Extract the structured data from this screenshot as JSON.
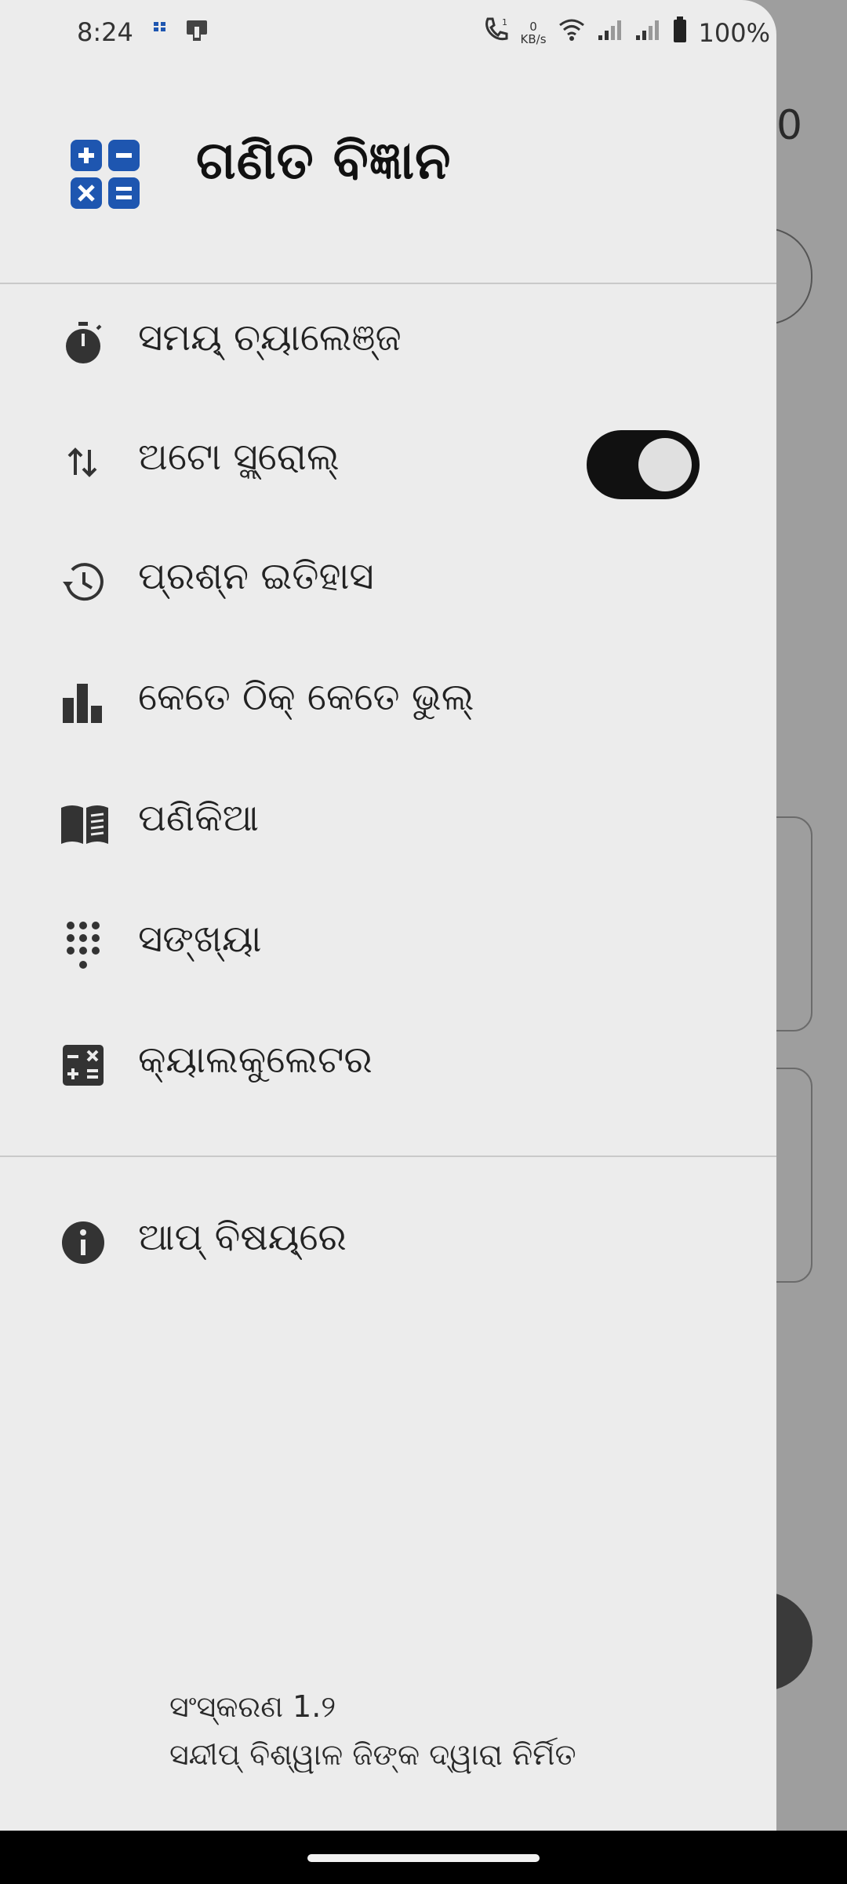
{
  "status_bar": {
    "time": "8:24",
    "net_speed_value": "0",
    "net_speed_unit": "KB/s",
    "battery": "100%"
  },
  "background": {
    "digit": "0"
  },
  "drawer": {
    "app_title": "ଗଣିତ ବିଜ୍ଞାନ",
    "menu": [
      {
        "label": "ସମୟ୍ ଚ୍ୟାଲେଞ୍ଜ",
        "icon": "stopwatch-icon"
      },
      {
        "label": "ଅଟୋ ସ୍କ୍ରୋଲ୍",
        "icon": "swap-vertical-icon",
        "toggle_on": true
      },
      {
        "label": "ପ୍ରଶ୍ନ ଇତିହାସ",
        "icon": "history-icon"
      },
      {
        "label": "କେତେ ଠିକ୍ କେତେ ଭୁଲ୍",
        "icon": "bar-chart-icon"
      },
      {
        "label": "ପଣିକିଆ",
        "icon": "book-icon"
      },
      {
        "label": "ସଙ୍ଖ୍ୟା",
        "icon": "dialpad-icon"
      },
      {
        "label": "କ୍ୟାଲକୁଲେଟର",
        "icon": "calculator-icon"
      }
    ],
    "about": {
      "label": "ଆପ୍ ବିଷୟ୍ରେ",
      "icon": "info-icon"
    },
    "footer": {
      "version": "ସଂସ୍କରଣ 1.୨",
      "credit": "ସନ୍ଦୀପ୍ ବିଶ୍ୱାଳ ଜିଙ୍କ ଦ୍ୱାରା ନିର୍ମିତ"
    }
  },
  "colors": {
    "accent": "#1e56b0",
    "drawer_bg": "#ececec",
    "scrim": "#9e9e9e"
  }
}
